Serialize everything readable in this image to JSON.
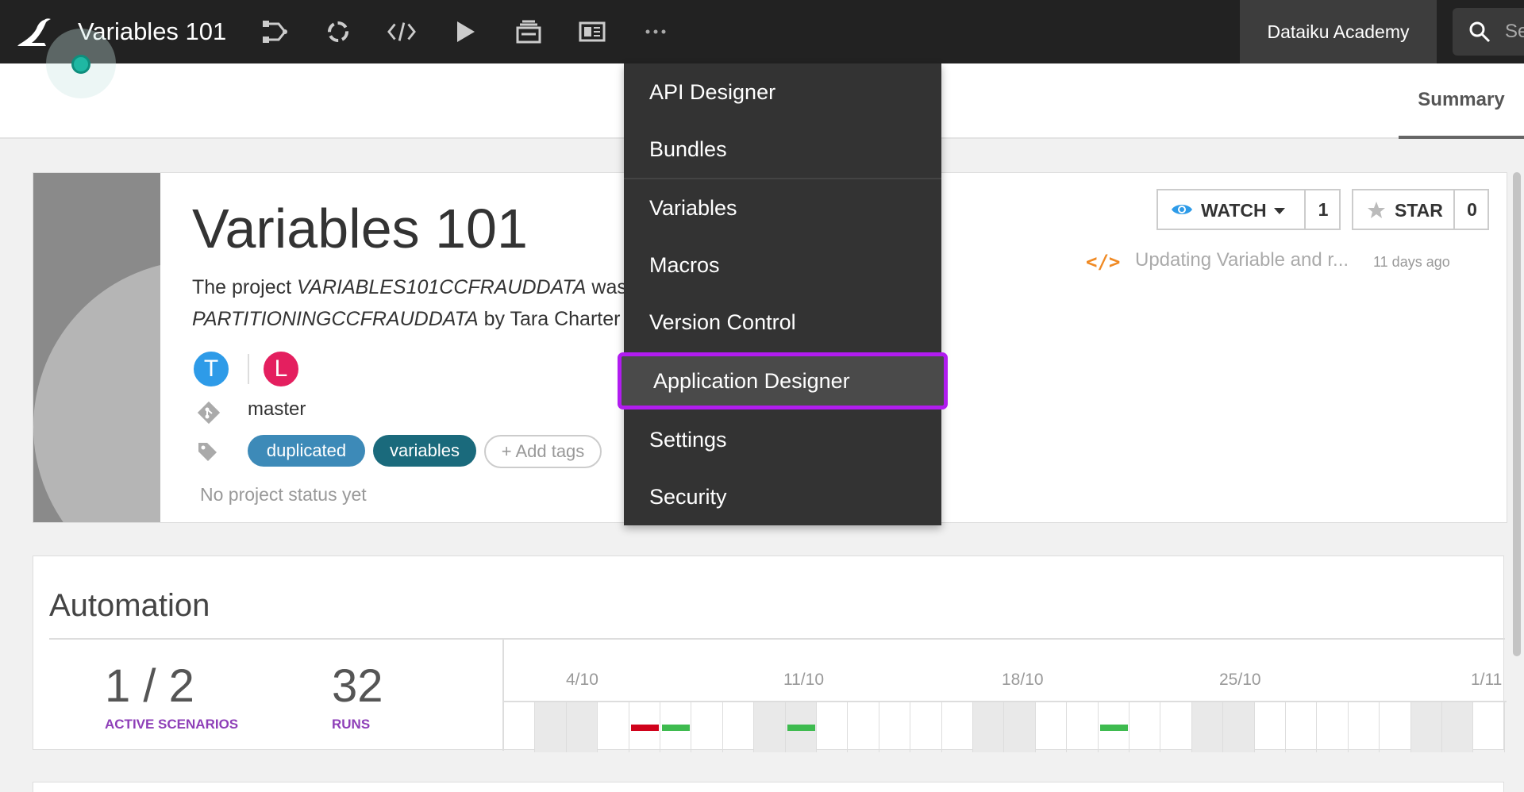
{
  "topbar": {
    "project_title": "Variables 101",
    "nav_icons": [
      "flow-icon",
      "lab-icon",
      "code-icon",
      "run-icon",
      "dashboard-icon",
      "app-icon",
      "more-icon"
    ],
    "workspace_label": "Dataiku Academy",
    "search_placeholder": "Se"
  },
  "subheader": {
    "summary_tab": "Summary"
  },
  "project": {
    "title": "Variables 101",
    "desc_prefix": "The project ",
    "desc_source": "VARIABLES101CCFRAUDDATA",
    "desc_mid": " was c",
    "desc_target": "PARTITIONINGCCFRAUDDATA",
    "desc_suffix": " by Tara Charter o",
    "avatars": [
      {
        "letter": "T",
        "color": "#2e9be8"
      },
      {
        "letter": "L",
        "color": "#e41f5f"
      }
    ],
    "branch": "master",
    "tags": [
      {
        "label": "duplicated",
        "color": "#3d8ab8"
      },
      {
        "label": "variables",
        "color": "#1a6a7c"
      }
    ],
    "add_tags_label": "+ Add tags",
    "status": "No project status yet",
    "watch_label": "WATCH",
    "watch_count": "1",
    "star_label": "STAR",
    "star_count": "0",
    "activity_text": "Updating Variable and r...",
    "activity_time": "11 days ago"
  },
  "automation": {
    "title": "Automation",
    "active_scenarios_value": "1 / 2",
    "active_scenarios_label": "ACTIVE SCENARIOS",
    "runs_value": "32",
    "runs_label": "RUNS",
    "timeline_dates": [
      "4/10",
      "11/10",
      "18/10",
      "25/10",
      "1/11"
    ],
    "run_bars": [
      {
        "day": 4,
        "status": "failed",
        "color": "#d0021b"
      },
      {
        "day": 5,
        "status": "success",
        "color": "#3ebb4f"
      },
      {
        "day": 9,
        "status": "success",
        "color": "#3ebb4f"
      },
      {
        "day": 19,
        "status": "success",
        "color": "#3ebb4f"
      }
    ]
  },
  "dropdown": {
    "items": [
      {
        "label": "API Designer",
        "key": "api-designer"
      },
      {
        "label": "Bundles",
        "key": "bundles"
      },
      {
        "label": "Variables",
        "key": "variables"
      },
      {
        "label": "Macros",
        "key": "macros"
      },
      {
        "label": "Version Control",
        "key": "version-control"
      },
      {
        "label": "Application Designer",
        "key": "application-designer",
        "highlighted": true
      },
      {
        "label": "Settings",
        "key": "settings"
      },
      {
        "label": "Security",
        "key": "security"
      }
    ],
    "highlight_color": "#b11cf0"
  }
}
